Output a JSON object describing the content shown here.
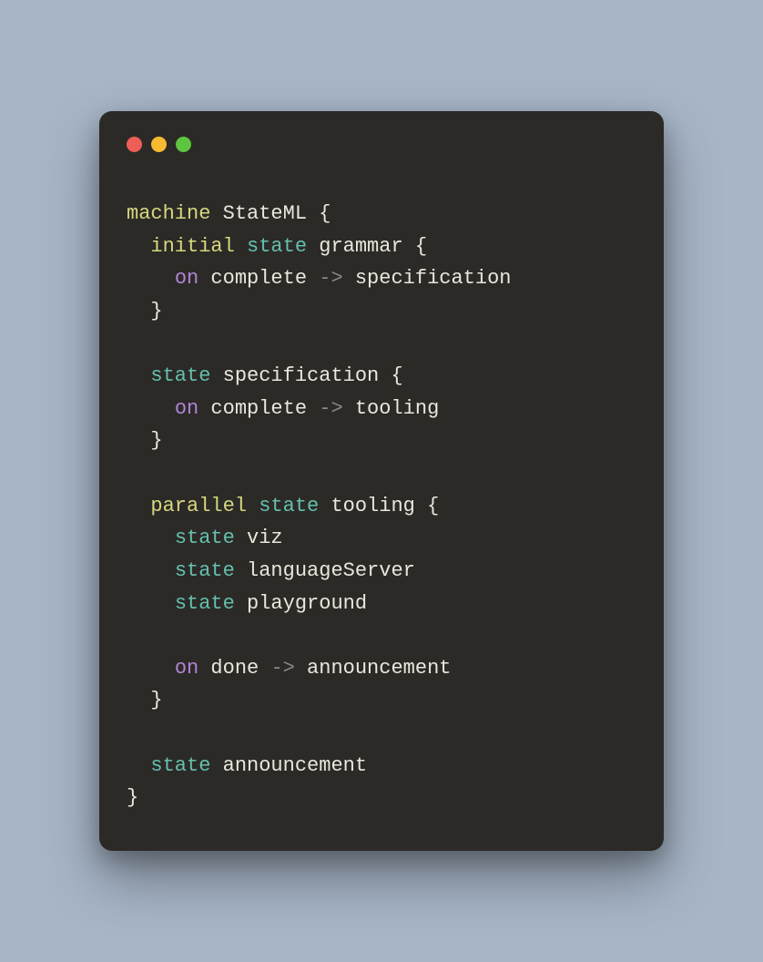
{
  "window": {
    "trafficLights": [
      "red",
      "yellow",
      "green"
    ]
  },
  "code": {
    "tokens": [
      [
        {
          "t": "machine",
          "c": "kw-machine"
        },
        {
          "t": " ",
          "c": "ident"
        },
        {
          "t": "StateML",
          "c": "ident"
        },
        {
          "t": " ",
          "c": "ident"
        },
        {
          "t": "{",
          "c": "brace"
        }
      ],
      [
        {
          "t": "  ",
          "c": "ident"
        },
        {
          "t": "initial",
          "c": "kw-initial"
        },
        {
          "t": " ",
          "c": "ident"
        },
        {
          "t": "state",
          "c": "kw-state"
        },
        {
          "t": " ",
          "c": "ident"
        },
        {
          "t": "grammar",
          "c": "ident"
        },
        {
          "t": " ",
          "c": "ident"
        },
        {
          "t": "{",
          "c": "brace"
        }
      ],
      [
        {
          "t": "    ",
          "c": "ident"
        },
        {
          "t": "on",
          "c": "kw-on"
        },
        {
          "t": " ",
          "c": "ident"
        },
        {
          "t": "complete",
          "c": "ident"
        },
        {
          "t": " ",
          "c": "ident"
        },
        {
          "t": "->",
          "c": "arrow"
        },
        {
          "t": " ",
          "c": "ident"
        },
        {
          "t": "specification",
          "c": "ident"
        }
      ],
      [
        {
          "t": "  ",
          "c": "ident"
        },
        {
          "t": "}",
          "c": "brace"
        }
      ],
      [
        {
          "t": "",
          "c": "ident"
        }
      ],
      [
        {
          "t": "  ",
          "c": "ident"
        },
        {
          "t": "state",
          "c": "kw-state"
        },
        {
          "t": " ",
          "c": "ident"
        },
        {
          "t": "specification",
          "c": "ident"
        },
        {
          "t": " ",
          "c": "ident"
        },
        {
          "t": "{",
          "c": "brace"
        }
      ],
      [
        {
          "t": "    ",
          "c": "ident"
        },
        {
          "t": "on",
          "c": "kw-on"
        },
        {
          "t": " ",
          "c": "ident"
        },
        {
          "t": "complete",
          "c": "ident"
        },
        {
          "t": " ",
          "c": "ident"
        },
        {
          "t": "->",
          "c": "arrow"
        },
        {
          "t": " ",
          "c": "ident"
        },
        {
          "t": "tooling",
          "c": "ident"
        }
      ],
      [
        {
          "t": "  ",
          "c": "ident"
        },
        {
          "t": "}",
          "c": "brace"
        }
      ],
      [
        {
          "t": "",
          "c": "ident"
        }
      ],
      [
        {
          "t": "  ",
          "c": "ident"
        },
        {
          "t": "parallel",
          "c": "kw-parallel"
        },
        {
          "t": " ",
          "c": "ident"
        },
        {
          "t": "state",
          "c": "kw-state"
        },
        {
          "t": " ",
          "c": "ident"
        },
        {
          "t": "tooling",
          "c": "ident"
        },
        {
          "t": " ",
          "c": "ident"
        },
        {
          "t": "{",
          "c": "brace"
        }
      ],
      [
        {
          "t": "    ",
          "c": "ident"
        },
        {
          "t": "state",
          "c": "kw-state"
        },
        {
          "t": " ",
          "c": "ident"
        },
        {
          "t": "viz",
          "c": "ident"
        }
      ],
      [
        {
          "t": "    ",
          "c": "ident"
        },
        {
          "t": "state",
          "c": "kw-state"
        },
        {
          "t": " ",
          "c": "ident"
        },
        {
          "t": "languageServer",
          "c": "ident"
        }
      ],
      [
        {
          "t": "    ",
          "c": "ident"
        },
        {
          "t": "state",
          "c": "kw-state"
        },
        {
          "t": " ",
          "c": "ident"
        },
        {
          "t": "playground",
          "c": "ident"
        }
      ],
      [
        {
          "t": "",
          "c": "ident"
        }
      ],
      [
        {
          "t": "    ",
          "c": "ident"
        },
        {
          "t": "on",
          "c": "kw-on"
        },
        {
          "t": " ",
          "c": "ident"
        },
        {
          "t": "done",
          "c": "ident"
        },
        {
          "t": " ",
          "c": "ident"
        },
        {
          "t": "->",
          "c": "arrow"
        },
        {
          "t": " ",
          "c": "ident"
        },
        {
          "t": "announcement",
          "c": "ident"
        }
      ],
      [
        {
          "t": "  ",
          "c": "ident"
        },
        {
          "t": "}",
          "c": "brace"
        }
      ],
      [
        {
          "t": "",
          "c": "ident"
        }
      ],
      [
        {
          "t": "  ",
          "c": "ident"
        },
        {
          "t": "state",
          "c": "kw-state"
        },
        {
          "t": " ",
          "c": "ident"
        },
        {
          "t": "announcement",
          "c": "ident"
        }
      ],
      [
        {
          "t": "}",
          "c": "brace"
        }
      ]
    ]
  }
}
